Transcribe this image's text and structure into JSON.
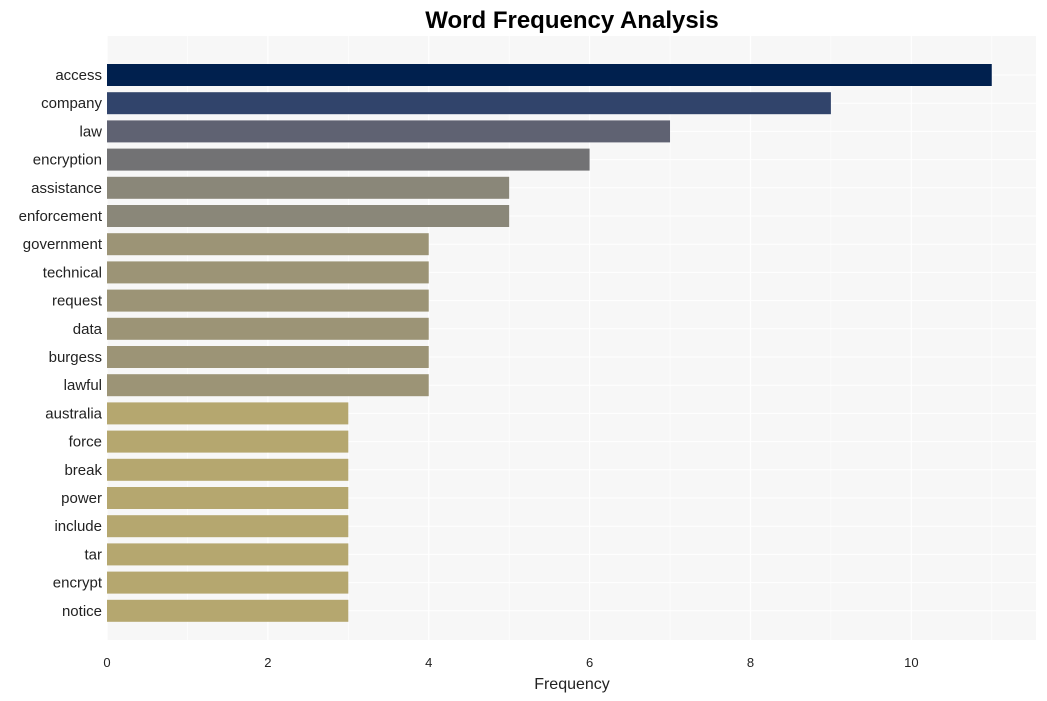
{
  "chart_data": {
    "type": "bar",
    "orientation": "horizontal",
    "title": "Word Frequency Analysis",
    "xlabel": "Frequency",
    "ylabel": "",
    "xlim": [
      0,
      11.55
    ],
    "xticks": [
      0,
      2,
      4,
      6,
      8,
      10
    ],
    "grid": true,
    "categories": [
      "access",
      "company",
      "law",
      "encryption",
      "assistance",
      "enforcement",
      "government",
      "technical",
      "request",
      "data",
      "burgess",
      "lawful",
      "australia",
      "force",
      "break",
      "power",
      "include",
      "tar",
      "encrypt",
      "notice"
    ],
    "values": [
      11,
      9,
      7,
      6,
      5,
      5,
      4,
      4,
      4,
      4,
      4,
      4,
      3,
      3,
      3,
      3,
      3,
      3,
      3,
      3
    ],
    "colors": [
      "#00204e",
      "#31446b",
      "#5f6272",
      "#727274",
      "#8a8779",
      "#8a8779",
      "#9c9476",
      "#9c9476",
      "#9c9476",
      "#9c9476",
      "#9c9476",
      "#9c9476",
      "#b5a76f",
      "#b5a76f",
      "#b5a76f",
      "#b5a76f",
      "#b5a76f",
      "#b5a76f",
      "#b5a76f",
      "#b5a76f"
    ],
    "background": "#f7f7f7"
  }
}
